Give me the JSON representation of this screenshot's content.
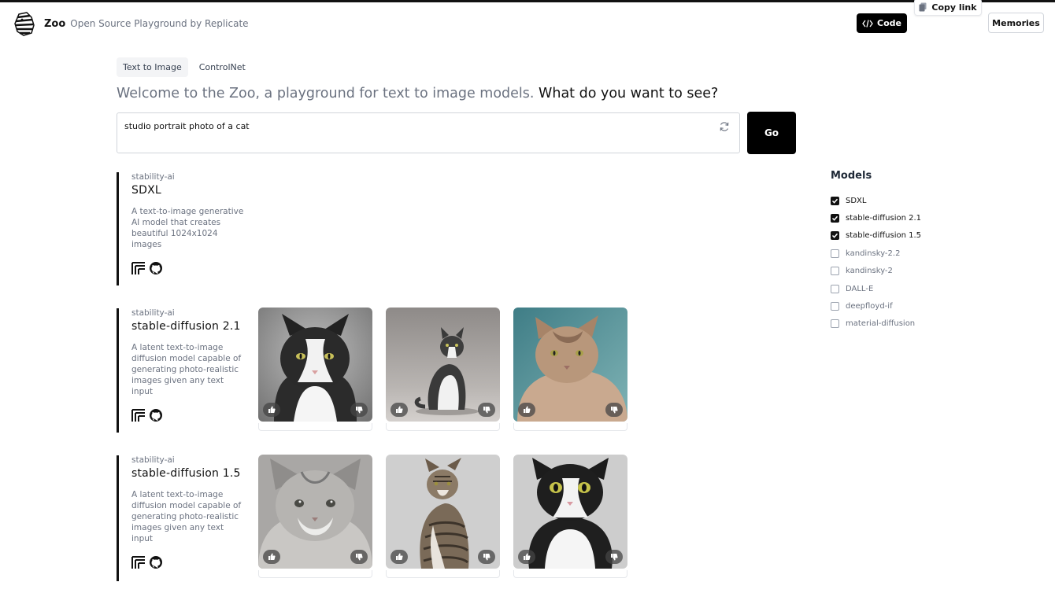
{
  "header": {
    "brand": "Zoo",
    "tagline": "Open Source Playground by Replicate",
    "code_label": "Code",
    "copy_link_label": "Copy link",
    "memories_label": "Memories"
  },
  "tabs": [
    {
      "label": "Text to Image",
      "active": true
    },
    {
      "label": "ControlNet",
      "active": false
    }
  ],
  "welcome": {
    "intro": "Welcome to the Zoo, a playground for text to image models.",
    "question": "What do you want to see?"
  },
  "prompt": {
    "value": "studio portrait photo of a cat",
    "go_label": "Go"
  },
  "results": [
    {
      "owner": "stability-ai",
      "name": "SDXL",
      "description": "A text-to-image generative AI model that creates beautiful 1024x1024 images",
      "images": []
    },
    {
      "owner": "stability-ai",
      "name": "stable-diffusion 2.1",
      "description": "A latent text-to-image diffusion model capable of generating photo-realistic images given any text input",
      "images": [
        "cat-photo",
        "cat-photo",
        "cat-photo"
      ]
    },
    {
      "owner": "stability-ai",
      "name": "stable-diffusion 1.5",
      "description": "A latent text-to-image diffusion model capable of generating photo-realistic images given any text input",
      "images": [
        "cat-photo",
        "cat-photo",
        "cat-photo"
      ]
    }
  ],
  "sidebar": {
    "title": "Models",
    "models": [
      {
        "label": "SDXL",
        "checked": true
      },
      {
        "label": "stable-diffusion 2.1",
        "checked": true
      },
      {
        "label": "stable-diffusion 1.5",
        "checked": true
      },
      {
        "label": "kandinsky-2.2",
        "checked": false
      },
      {
        "label": "kandinsky-2",
        "checked": false
      },
      {
        "label": "DALL-E",
        "checked": false
      },
      {
        "label": "deepfloyd-if",
        "checked": false
      },
      {
        "label": "material-diffusion",
        "checked": false
      }
    ]
  },
  "icons": {
    "logo": "zebra-logo-icon",
    "code": "code-brackets-icon",
    "copy": "copy-icon",
    "refresh": "refresh-icon",
    "replicate": "replicate-icon",
    "github": "github-icon",
    "thumbs_up": "thumbs-up-icon",
    "thumbs_down": "thumbs-down-icon"
  },
  "colors": {
    "primary_button": "#000000",
    "muted_text": "#6b7280",
    "border": "#d1d5db"
  }
}
